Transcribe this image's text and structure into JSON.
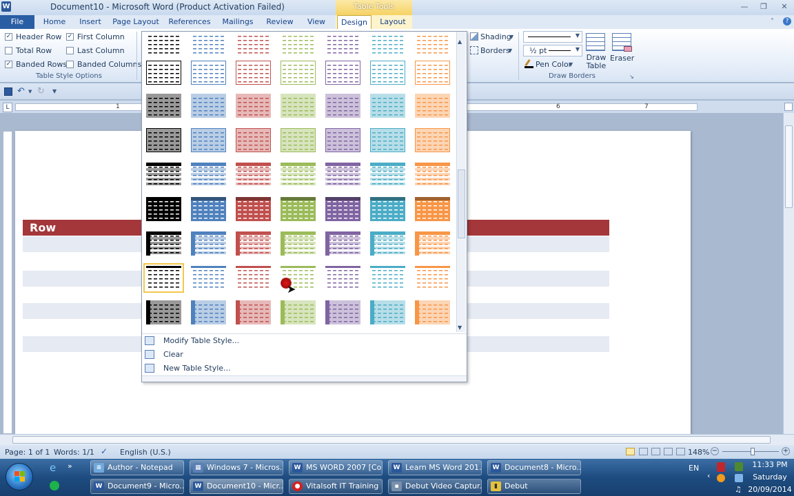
{
  "window": {
    "title": "Document10 - Microsoft Word (Product Activation Failed)",
    "context_tab_group": "Table Tools"
  },
  "tabs": {
    "file": "File",
    "items": [
      "Home",
      "Insert",
      "Page Layout",
      "References",
      "Mailings",
      "Review",
      "View",
      "Design",
      "Layout"
    ],
    "active": "Design"
  },
  "table_style_options": {
    "group_label": "Table Style Options",
    "header_row": {
      "label": "Header Row",
      "checked": true
    },
    "total_row": {
      "label": "Total Row",
      "checked": false
    },
    "banded_rows": {
      "label": "Banded Rows",
      "checked": true
    },
    "first_column": {
      "label": "First Column",
      "checked": true
    },
    "last_column": {
      "label": "Last Column",
      "checked": false
    },
    "banded_columns": {
      "label": "Banded Columns",
      "checked": false
    }
  },
  "table_styles_group": {
    "shading": "Shading",
    "borders": "Borders"
  },
  "draw_borders": {
    "group_label": "Draw Borders",
    "pen_weight": "½ pt",
    "pen_color": "Pen Color",
    "draw_table": "Draw Table",
    "eraser": "Eraser"
  },
  "gallery": {
    "colors": [
      "#000000",
      "#4f81bd",
      "#c0504d",
      "#9bbb59",
      "#8064a2",
      "#4bacc6",
      "#f79646"
    ],
    "menu": {
      "modify": "Modify Table Style...",
      "clear": "Clear",
      "new": "New Table Style..."
    }
  },
  "ruler": {
    "h_marks": [
      "1",
      "6",
      "7"
    ]
  },
  "document": {
    "table_header_text": "Row",
    "header_color": "#a3373a",
    "band_color": "#e5eaf3"
  },
  "status": {
    "page": "Page: 1 of 1",
    "words": "Words: 1/1",
    "language": "English (U.S.)",
    "zoom": "148%"
  },
  "taskbar": {
    "row1": [
      "Author - Notepad",
      "Windows 7 - Micros...",
      "MS WORD 2007 [Co...",
      "Learn MS Word 201...",
      "Document8 - Micro..."
    ],
    "row2": [
      "Document9 - Micro...",
      "Document10 - Micr...",
      "Vitalsoft IT Training ...",
      "Debut Video Captur...",
      "Debut"
    ],
    "lang": "EN",
    "time": "11:33 PM",
    "day": "Saturday",
    "date": "20/09/2014"
  }
}
